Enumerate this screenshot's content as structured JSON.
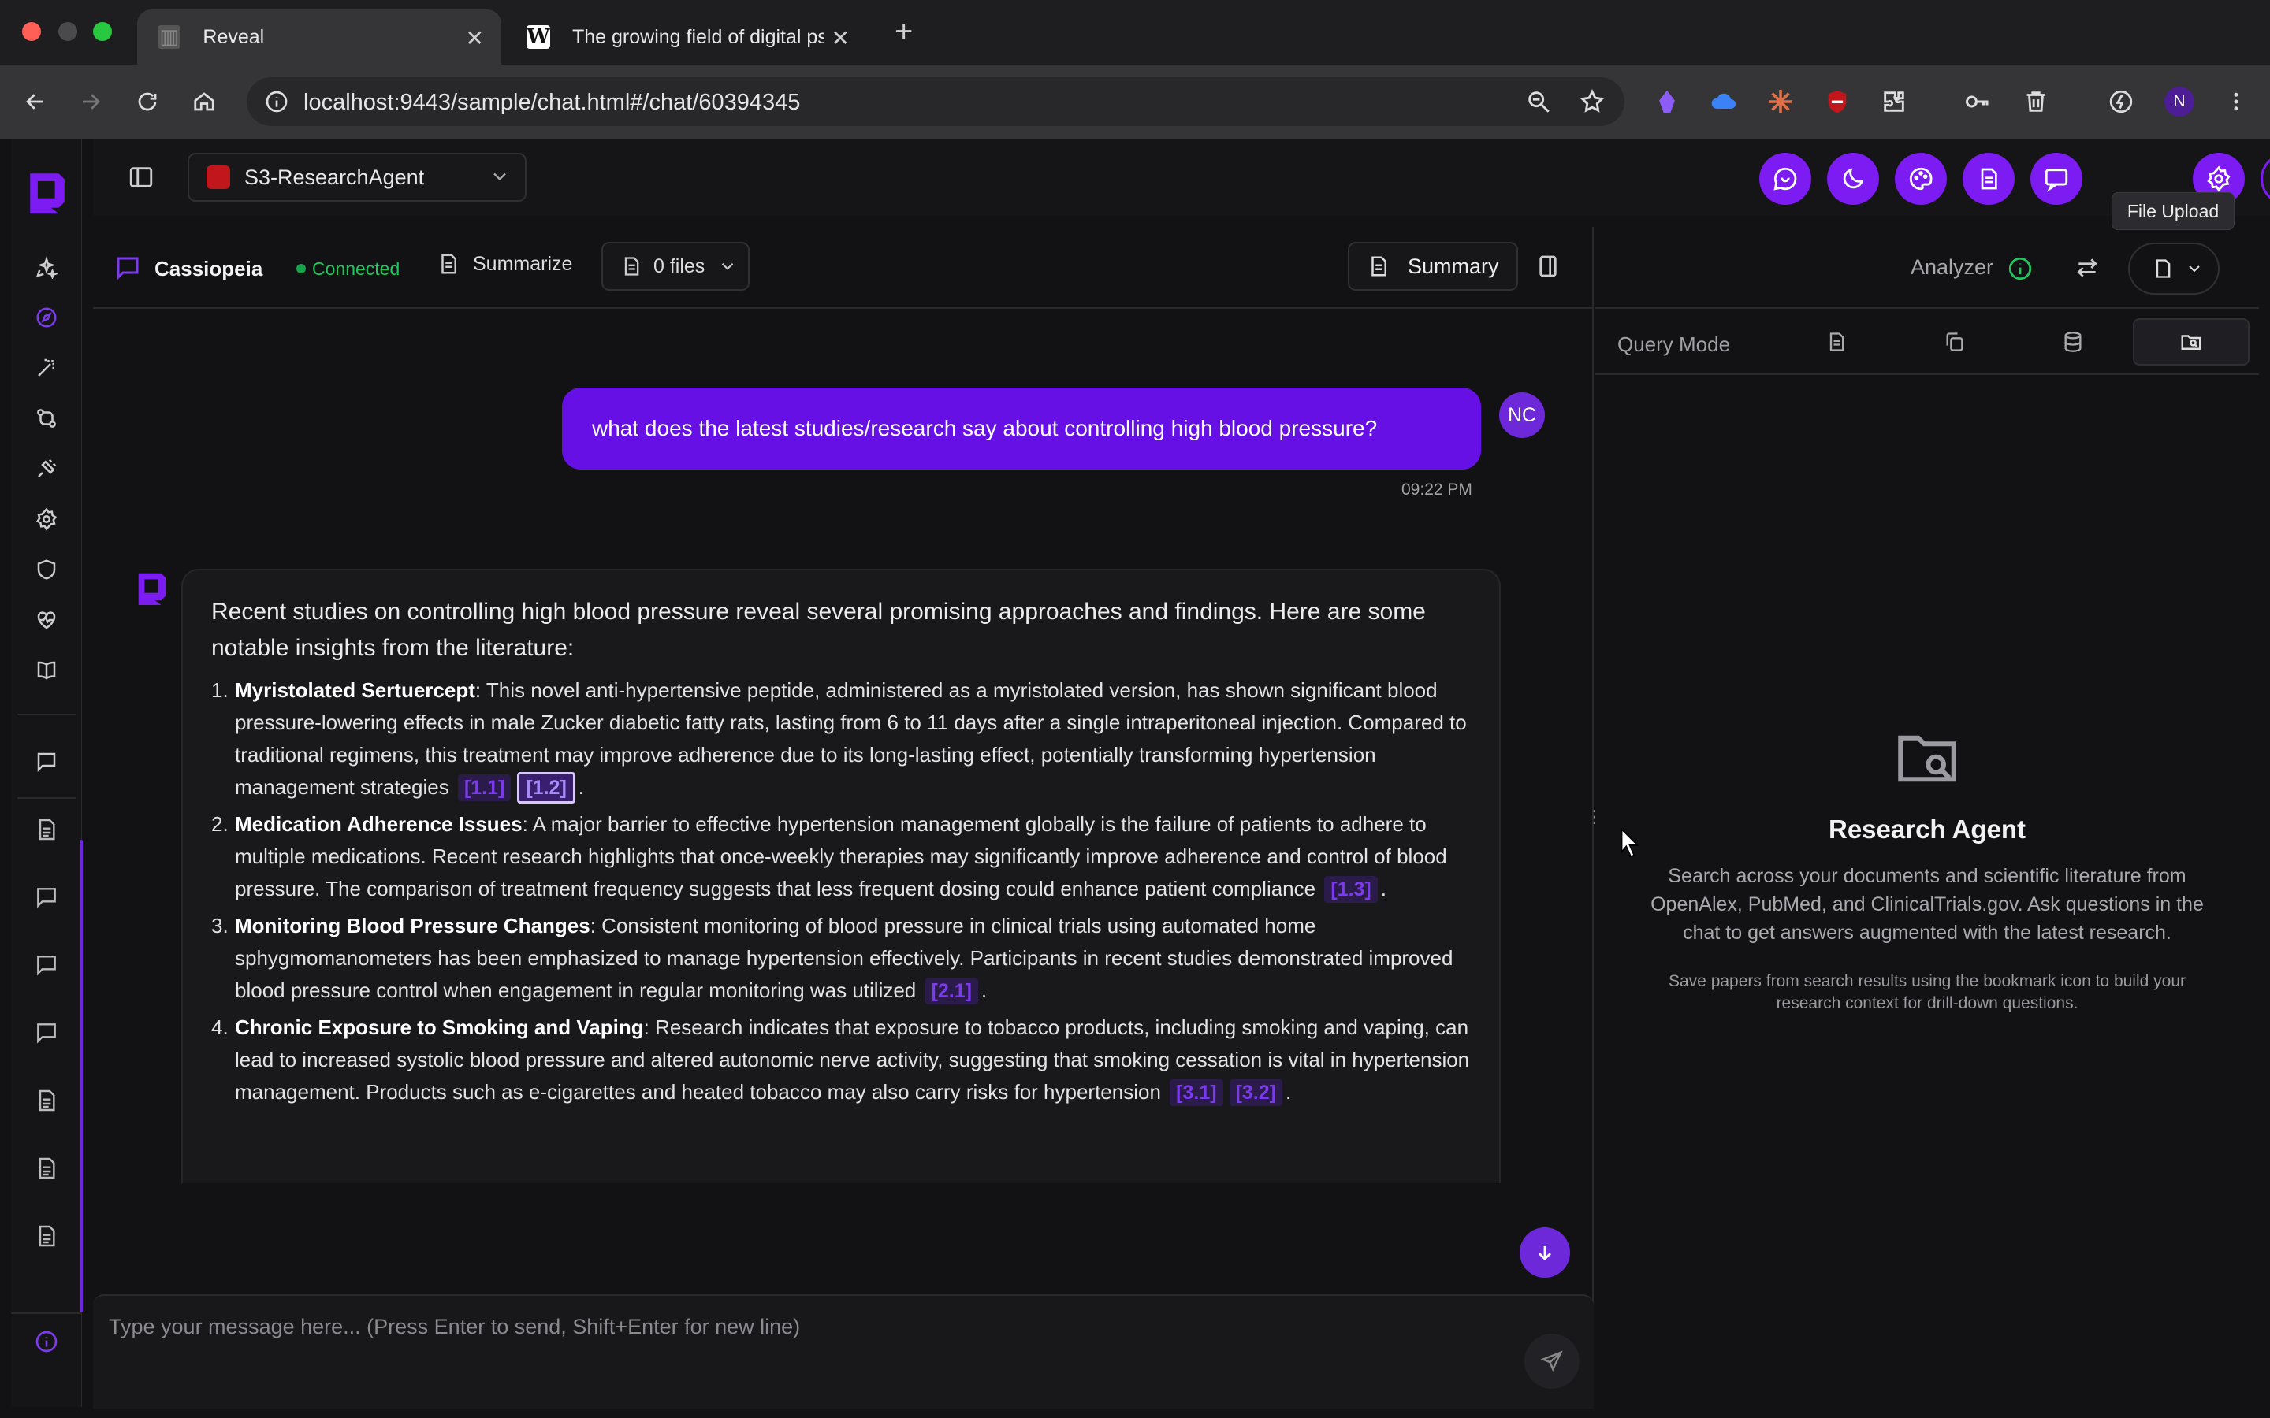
{
  "browser": {
    "tabs": [
      {
        "title": "Reveal",
        "active": true
      },
      {
        "title": "The growing field of digital ps",
        "active": false
      }
    ],
    "url": "localhost:9443/sample/chat.html#/chat/60394345",
    "profile_initial": "N"
  },
  "app": {
    "agent_selector": "S3-ResearchAgent",
    "header_avatar": "NC",
    "tooltip": "File Upload",
    "accent": "#7c1bf2"
  },
  "chat": {
    "title": "Cassiopeia",
    "status": "Connected",
    "summarize_label": "Summarize",
    "files_label": "0 files",
    "summary_label": "Summary",
    "user_message": "what does the latest studies/research say about controlling high blood pressure?",
    "user_avatar": "NC",
    "user_time": "09:22 PM",
    "bot_intro": "Recent studies on controlling high blood pressure reveal several promising approaches and findings. Here are some notable insights from the literature:",
    "items": [
      {
        "num": "1.",
        "title": "Myristolated Sertuercept",
        "text": ": This novel anti-hypertensive peptide, administered as a myristolated version, has shown significant blood pressure-lowering effects in male Zucker diabetic fatty rats, lasting from 6 to 11 days after a single intraperitoneal injection. Compared to traditional regimens, this treatment may improve adherence due to its long-lasting effect, potentially transforming hypertension management strategies",
        "cites": [
          "[1.1]",
          "[1.2]"
        ],
        "end": "."
      },
      {
        "num": "2.",
        "title": "Medication Adherence Issues",
        "text": ": A major barrier to effective hypertension management globally is the failure of patients to adhere to multiple medications. Recent research highlights that once-weekly therapies may significantly improve adherence and control of blood pressure. The comparison of treatment frequency suggests that less frequent dosing could enhance patient compliance",
        "cites": [
          "[1.3]"
        ],
        "end": "."
      },
      {
        "num": "3.",
        "title": "Monitoring Blood Pressure Changes",
        "text": ": Consistent monitoring of blood pressure in clinical trials using automated home sphygmomanometers has been emphasized to manage hypertension effectively. Participants in recent studies demonstrated improved blood pressure control when engagement in regular monitoring was utilized",
        "cites": [
          "[2.1]"
        ],
        "end": "."
      },
      {
        "num": "4.",
        "title": "Chronic Exposure to Smoking and Vaping",
        "text": ": Research indicates that exposure to tobacco products, including smoking and vaping, can lead to increased systolic blood pressure and altered autonomic nerve activity, suggesting that smoking cessation is vital in hypertension management. Products such as e-cigarettes and heated tobacco may also carry risks for hypertension",
        "cites": [
          "[3.1]",
          "[3.2]"
        ],
        "end": "."
      }
    ],
    "composer_placeholder": "Type your message here... (Press Enter to send, Shift+Enter for new line)"
  },
  "panel": {
    "analyzer_label": "Analyzer",
    "query_mode_label": "Query Mode",
    "empty_title": "Research Agent",
    "empty_desc": "Search across your documents and scientific literature from OpenAlex, PubMed, and ClinicalTrials.gov. Ask questions in the chat to get answers augmented with the latest research.",
    "empty_note": "Save papers from search results using the bookmark icon to build your research context for drill-down questions."
  }
}
